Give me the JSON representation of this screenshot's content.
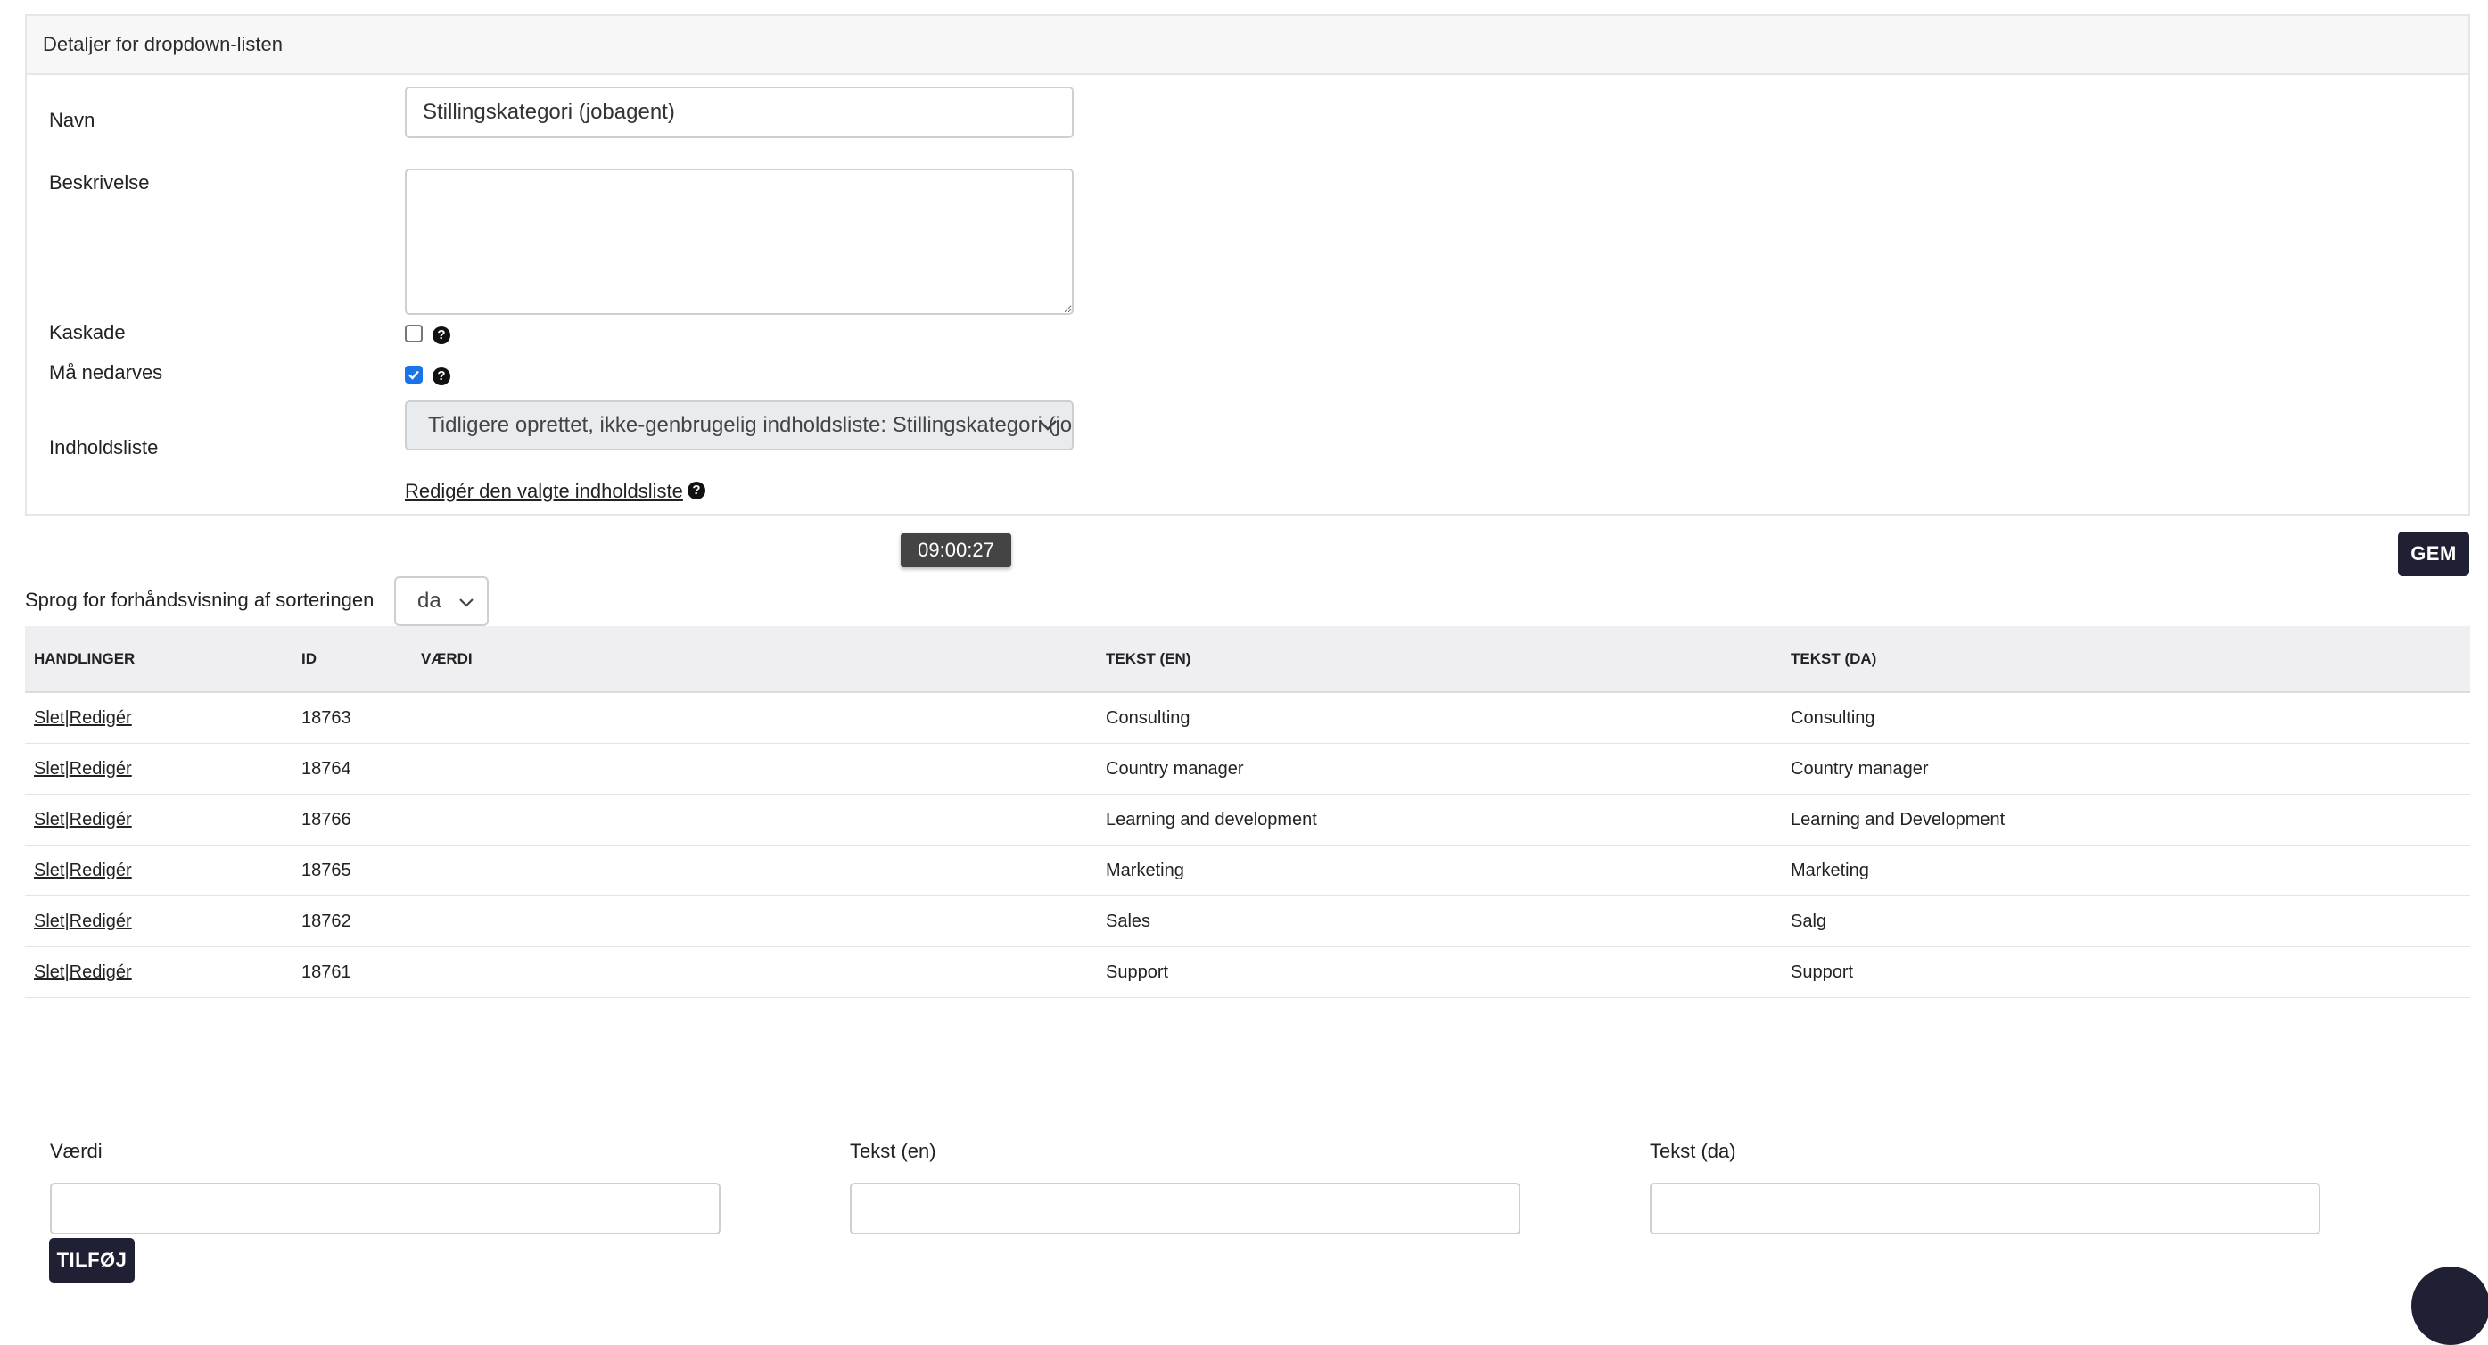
{
  "panel": {
    "title": "Detaljer for dropdown-listen",
    "name_label": "Navn",
    "name_value": "Stillingskategori (jobagent)",
    "description_label": "Beskrivelse",
    "description_value": "",
    "cascade_label": "Kaskade",
    "cascade_checked": false,
    "inherit_label": "Må nedarves",
    "inherit_checked": true,
    "content_list_label": "Indholdsliste",
    "content_list_value": "Tidligere oprettet, ikke-genbrugelig indholdsliste: Stillingskategori (jobagent)",
    "edit_link": "Redigér den valgte indholdsliste",
    "help_glyph": "?"
  },
  "tooltip": "09:00:27",
  "save_button": "GEM",
  "sort": {
    "label": "Sprog for forhåndsvisning af sorteringen",
    "value": "da"
  },
  "table": {
    "headers": [
      "HANDLINGER",
      "ID",
      "VÆRDI",
      "TEKST (EN)",
      "TEKST (DA)"
    ],
    "delete_label": "Slet",
    "separator": "|",
    "edit_label": "Redigér",
    "rows": [
      {
        "id": "18763",
        "value": "",
        "text_en": "Consulting",
        "text_da": "Consulting"
      },
      {
        "id": "18764",
        "value": "",
        "text_en": "Country manager",
        "text_da": "Country manager"
      },
      {
        "id": "18766",
        "value": "",
        "text_en": "Learning and development",
        "text_da": "Learning and Development"
      },
      {
        "id": "18765",
        "value": "",
        "text_en": "Marketing",
        "text_da": "Marketing"
      },
      {
        "id": "18762",
        "value": "",
        "text_en": "Sales",
        "text_da": "Salg"
      },
      {
        "id": "18761",
        "value": "",
        "text_en": "Support",
        "text_da": "Support"
      }
    ]
  },
  "add_form": {
    "value_label": "Værdi",
    "text_en_label": "Tekst (en)",
    "text_da_label": "Tekst (da)",
    "value": "",
    "text_en": "",
    "text_da": "",
    "add_button": "TILFØJ"
  },
  "colors": {
    "dark_button": "#1f2034",
    "checkbox_accent": "#1a73e8",
    "table_header_bg": "#efeff1"
  }
}
